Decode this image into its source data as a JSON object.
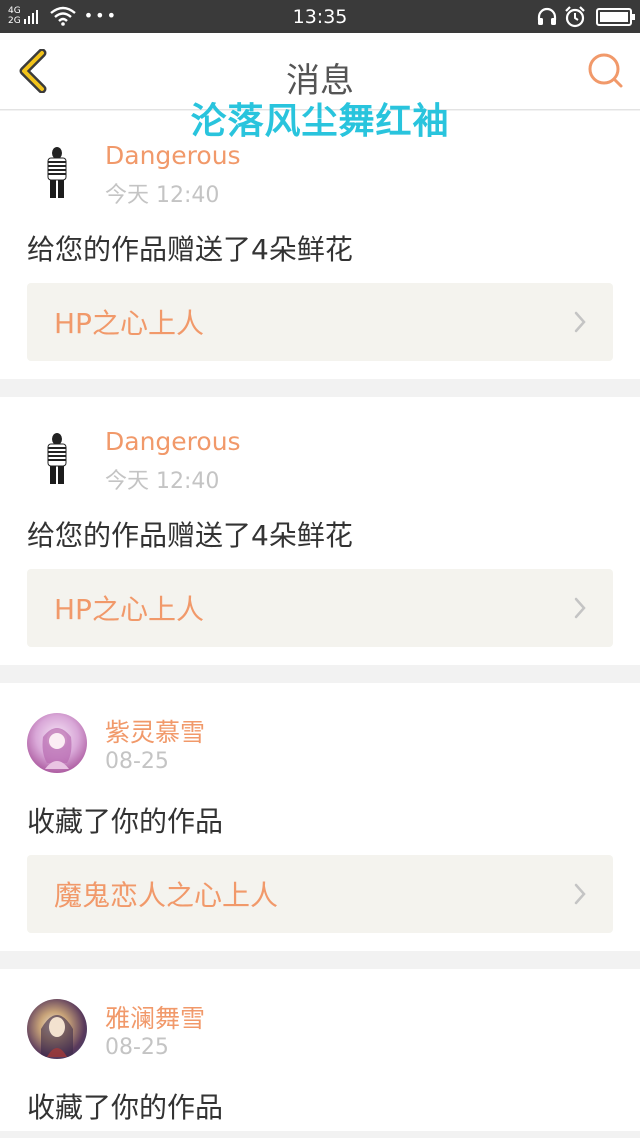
{
  "status_bar": {
    "network_top": "4G",
    "network_bottom": "2G",
    "time": "13:35"
  },
  "header": {
    "title": "消息",
    "watermark": "沦落风尘舞红袖"
  },
  "colors": {
    "accent": "#f1996a",
    "icon_yellow": "#f2c31a",
    "watermark": "#29c4dd"
  },
  "icons": {
    "back": "chevron-left-icon",
    "search": "search-icon",
    "row_arrow": "chevron-right-icon"
  },
  "messages": [
    {
      "username": "Dangerous",
      "time": "今天 12:40",
      "text": "给您的作品赠送了4朵鲜花",
      "work": "HP之心上人"
    },
    {
      "username": "Dangerous",
      "time": "今天 12:40",
      "text": "给您的作品赠送了4朵鲜花",
      "work": "HP之心上人"
    },
    {
      "username": "紫灵慕雪",
      "time": "08-25",
      "text": "收藏了你的作品",
      "work": "魔鬼恋人之心上人"
    },
    {
      "username": "雅澜舞雪",
      "time": "08-25",
      "text": "收藏了你的作品"
    }
  ]
}
